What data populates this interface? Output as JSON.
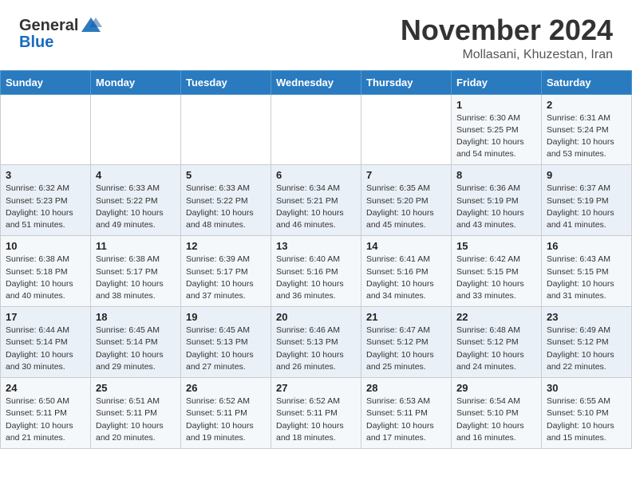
{
  "header": {
    "logo_general": "General",
    "logo_blue": "Blue",
    "month": "November 2024",
    "location": "Mollasani, Khuzestan, Iran"
  },
  "days_of_week": [
    "Sunday",
    "Monday",
    "Tuesday",
    "Wednesday",
    "Thursday",
    "Friday",
    "Saturday"
  ],
  "weeks": [
    [
      {
        "day": "",
        "info": ""
      },
      {
        "day": "",
        "info": ""
      },
      {
        "day": "",
        "info": ""
      },
      {
        "day": "",
        "info": ""
      },
      {
        "day": "",
        "info": ""
      },
      {
        "day": "1",
        "info": "Sunrise: 6:30 AM\nSunset: 5:25 PM\nDaylight: 10 hours\nand 54 minutes."
      },
      {
        "day": "2",
        "info": "Sunrise: 6:31 AM\nSunset: 5:24 PM\nDaylight: 10 hours\nand 53 minutes."
      }
    ],
    [
      {
        "day": "3",
        "info": "Sunrise: 6:32 AM\nSunset: 5:23 PM\nDaylight: 10 hours\nand 51 minutes."
      },
      {
        "day": "4",
        "info": "Sunrise: 6:33 AM\nSunset: 5:22 PM\nDaylight: 10 hours\nand 49 minutes."
      },
      {
        "day": "5",
        "info": "Sunrise: 6:33 AM\nSunset: 5:22 PM\nDaylight: 10 hours\nand 48 minutes."
      },
      {
        "day": "6",
        "info": "Sunrise: 6:34 AM\nSunset: 5:21 PM\nDaylight: 10 hours\nand 46 minutes."
      },
      {
        "day": "7",
        "info": "Sunrise: 6:35 AM\nSunset: 5:20 PM\nDaylight: 10 hours\nand 45 minutes."
      },
      {
        "day": "8",
        "info": "Sunrise: 6:36 AM\nSunset: 5:19 PM\nDaylight: 10 hours\nand 43 minutes."
      },
      {
        "day": "9",
        "info": "Sunrise: 6:37 AM\nSunset: 5:19 PM\nDaylight: 10 hours\nand 41 minutes."
      }
    ],
    [
      {
        "day": "10",
        "info": "Sunrise: 6:38 AM\nSunset: 5:18 PM\nDaylight: 10 hours\nand 40 minutes."
      },
      {
        "day": "11",
        "info": "Sunrise: 6:38 AM\nSunset: 5:17 PM\nDaylight: 10 hours\nand 38 minutes."
      },
      {
        "day": "12",
        "info": "Sunrise: 6:39 AM\nSunset: 5:17 PM\nDaylight: 10 hours\nand 37 minutes."
      },
      {
        "day": "13",
        "info": "Sunrise: 6:40 AM\nSunset: 5:16 PM\nDaylight: 10 hours\nand 36 minutes."
      },
      {
        "day": "14",
        "info": "Sunrise: 6:41 AM\nSunset: 5:16 PM\nDaylight: 10 hours\nand 34 minutes."
      },
      {
        "day": "15",
        "info": "Sunrise: 6:42 AM\nSunset: 5:15 PM\nDaylight: 10 hours\nand 33 minutes."
      },
      {
        "day": "16",
        "info": "Sunrise: 6:43 AM\nSunset: 5:15 PM\nDaylight: 10 hours\nand 31 minutes."
      }
    ],
    [
      {
        "day": "17",
        "info": "Sunrise: 6:44 AM\nSunset: 5:14 PM\nDaylight: 10 hours\nand 30 minutes."
      },
      {
        "day": "18",
        "info": "Sunrise: 6:45 AM\nSunset: 5:14 PM\nDaylight: 10 hours\nand 29 minutes."
      },
      {
        "day": "19",
        "info": "Sunrise: 6:45 AM\nSunset: 5:13 PM\nDaylight: 10 hours\nand 27 minutes."
      },
      {
        "day": "20",
        "info": "Sunrise: 6:46 AM\nSunset: 5:13 PM\nDaylight: 10 hours\nand 26 minutes."
      },
      {
        "day": "21",
        "info": "Sunrise: 6:47 AM\nSunset: 5:12 PM\nDaylight: 10 hours\nand 25 minutes."
      },
      {
        "day": "22",
        "info": "Sunrise: 6:48 AM\nSunset: 5:12 PM\nDaylight: 10 hours\nand 24 minutes."
      },
      {
        "day": "23",
        "info": "Sunrise: 6:49 AM\nSunset: 5:12 PM\nDaylight: 10 hours\nand 22 minutes."
      }
    ],
    [
      {
        "day": "24",
        "info": "Sunrise: 6:50 AM\nSunset: 5:11 PM\nDaylight: 10 hours\nand 21 minutes."
      },
      {
        "day": "25",
        "info": "Sunrise: 6:51 AM\nSunset: 5:11 PM\nDaylight: 10 hours\nand 20 minutes."
      },
      {
        "day": "26",
        "info": "Sunrise: 6:52 AM\nSunset: 5:11 PM\nDaylight: 10 hours\nand 19 minutes."
      },
      {
        "day": "27",
        "info": "Sunrise: 6:52 AM\nSunset: 5:11 PM\nDaylight: 10 hours\nand 18 minutes."
      },
      {
        "day": "28",
        "info": "Sunrise: 6:53 AM\nSunset: 5:11 PM\nDaylight: 10 hours\nand 17 minutes."
      },
      {
        "day": "29",
        "info": "Sunrise: 6:54 AM\nSunset: 5:10 PM\nDaylight: 10 hours\nand 16 minutes."
      },
      {
        "day": "30",
        "info": "Sunrise: 6:55 AM\nSunset: 5:10 PM\nDaylight: 10 hours\nand 15 minutes."
      }
    ]
  ]
}
